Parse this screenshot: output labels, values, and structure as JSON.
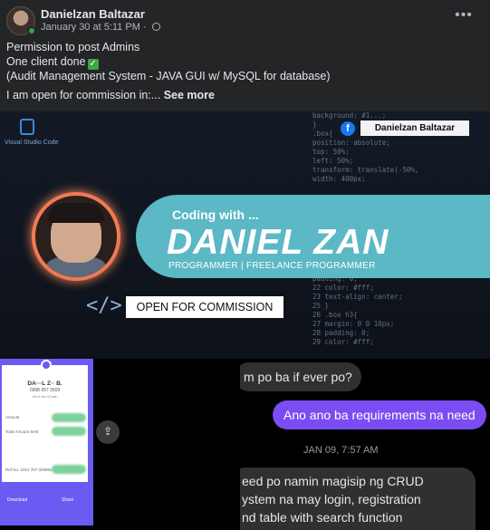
{
  "post": {
    "author": "Danielzan Baltazar",
    "date": "January 30 at 5:11 PM",
    "more_label": "•••",
    "lines": [
      "Permission to post Admins",
      "One client done",
      "(Audit Management System - JAVA GUI w/ MySQL for database)",
      "I am open for commission in:..."
    ],
    "see_more": "See more"
  },
  "banner": {
    "vs_caption": "Visual Studio Code",
    "fb_name": "Danielzan Baltazar",
    "coding_with": "Coding with ...",
    "big_name": "DANIEL ZAN",
    "subtitle": "PROGRAMMER | FREELANCE PROGRAMMER",
    "code_symbol": "</>",
    "open_commission": "OPEN FOR COMMISSION",
    "code_lines": [
      "background: #1...;",
      "}",
      ".box{",
      "  position: absolute;",
      "  top: 50%;",
      "  left: 50%;",
      "  transform: translate(-50%,",
      "  width: 400px;",
      "",
      "",
      "",
      "",
      "",
      "",
      "",
      "",
      "",
      "",
      "  padding: 0;",
      "22  color: #fff;",
      "23  text-align: center;",
      "25 }",
      "26 .box h3{",
      "27  margin: 0 0 10px;",
      "28  padding: 0;",
      "29  color: #fff;"
    ]
  },
  "receipt": {
    "title": "DA···L Z·· B.",
    "number": "0998 957 3509",
    "sent": "Sent via GCash",
    "amount_label": "Amount",
    "total_label": "Total Amount Sent",
    "ref_label": "Ref No. 1014 767 328962",
    "download_label": "Download",
    "share_label": "Share"
  },
  "share_icon": "⇪",
  "chat": {
    "msg1": "m po ba if ever po?",
    "msg2": "Ano ano ba requirements na need",
    "time": "JAN 09, 7:57 AM",
    "msg3_lines": [
      "eed po namin magisip ng CRUD",
      "ystem na may login, registration",
      "nd table with search function"
    ]
  }
}
